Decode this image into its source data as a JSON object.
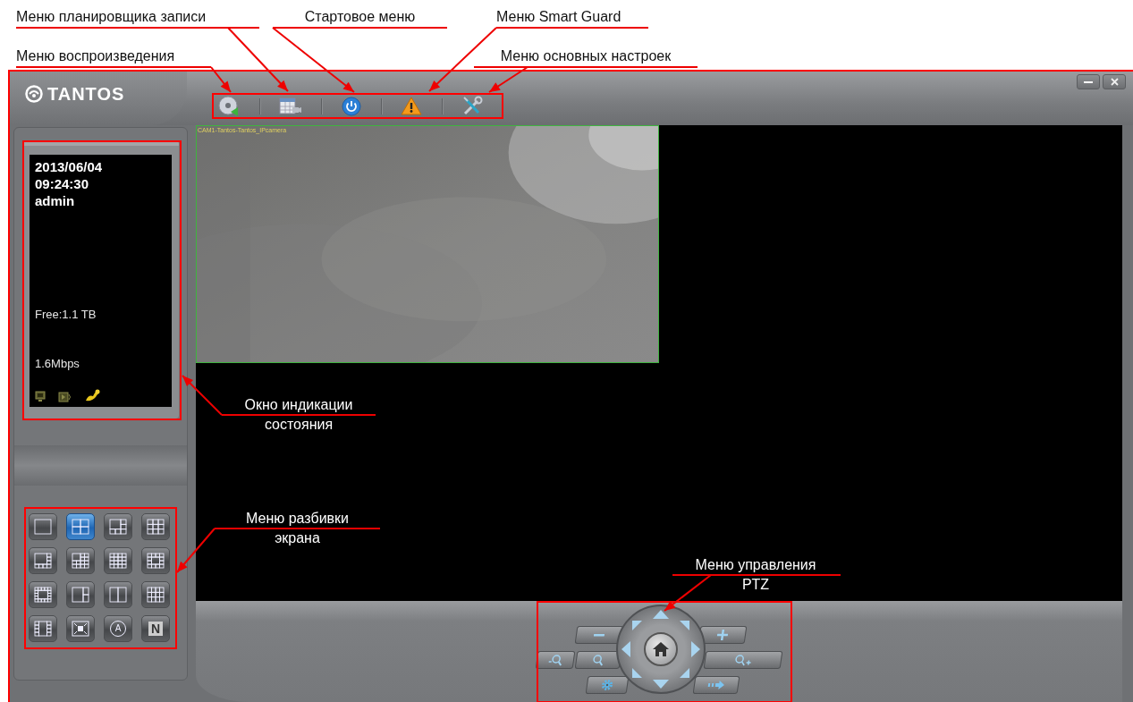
{
  "annotations": [
    {
      "text": "Меню планировщика записи"
    },
    {
      "text": "Стартовое меню"
    },
    {
      "text": "Меню Smart Guard"
    },
    {
      "text": "Меню воспроизведения"
    },
    {
      "text": "Меню основных настроек"
    },
    {
      "text": "Окно индикации состояния"
    },
    {
      "text": "Меню разбивки экрана"
    },
    {
      "text": "Меню управления PTZ"
    }
  ],
  "window": {
    "logo": "TANTOS"
  },
  "status_panel": {
    "date": "2013/06/04",
    "time": "09:24:30",
    "user": "admin",
    "free_space": "Free:1.1 TB",
    "bitrate": "1.6Mbps"
  },
  "camera": {
    "title": "CAM1-Tantos-Tantos_IPcamera"
  },
  "layouts": [
    {
      "kind": "single",
      "selected": false
    },
    {
      "kind": "quad",
      "selected": true
    },
    {
      "kind": "six",
      "selected": false
    },
    {
      "kind": "nine",
      "selected": false
    },
    {
      "kind": "eight",
      "selected": false
    },
    {
      "kind": "thirteen",
      "selected": false
    },
    {
      "kind": "sixteen",
      "selected": false
    },
    {
      "kind": "center",
      "selected": false
    },
    {
      "kind": "ring",
      "selected": false
    },
    {
      "kind": "three",
      "selected": false
    },
    {
      "kind": "two",
      "selected": false
    },
    {
      "kind": "twelve",
      "selected": false
    },
    {
      "kind": "middle",
      "selected": false
    },
    {
      "kind": "fullscreen",
      "selected": false
    },
    {
      "kind": "auto",
      "label": "A",
      "selected": false
    },
    {
      "kind": "manual",
      "label": "N",
      "selected": false
    }
  ]
}
